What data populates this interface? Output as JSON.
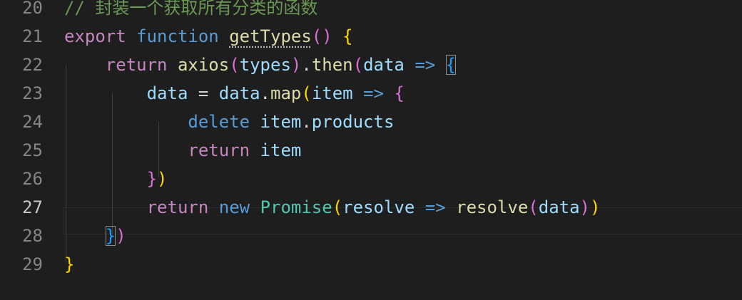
{
  "editor": {
    "theme": "dark",
    "background": "#1e1e1e",
    "active_line": "27",
    "lines": [
      {
        "number": "20",
        "tokens": [
          {
            "text": "// 封装一个获取所有分类的函数",
            "type": "comment"
          }
        ]
      },
      {
        "number": "21",
        "tokens": [
          {
            "text": "export",
            "type": "control"
          },
          {
            "text": " ",
            "type": "op"
          },
          {
            "text": "function",
            "type": "keyword"
          },
          {
            "text": " ",
            "type": "op"
          },
          {
            "text": "getTypes",
            "type": "func",
            "squiggle": true
          },
          {
            "text": "()",
            "type": "b2"
          },
          {
            "text": " ",
            "type": "op"
          },
          {
            "text": "{",
            "type": "b1"
          }
        ]
      },
      {
        "number": "22",
        "tokens": [
          {
            "text": "    ",
            "type": "op"
          },
          {
            "text": "return",
            "type": "control"
          },
          {
            "text": " ",
            "type": "op"
          },
          {
            "text": "axios",
            "type": "func"
          },
          {
            "text": "(",
            "type": "b2"
          },
          {
            "text": "types",
            "type": "var"
          },
          {
            "text": ")",
            "type": "b2"
          },
          {
            "text": ".",
            "type": "op"
          },
          {
            "text": "then",
            "type": "func"
          },
          {
            "text": "(",
            "type": "b2"
          },
          {
            "text": "data",
            "type": "var"
          },
          {
            "text": " ",
            "type": "op"
          },
          {
            "text": "=>",
            "type": "keyword"
          },
          {
            "text": " ",
            "type": "op"
          },
          {
            "text": "{",
            "type": "b3",
            "boxed": true
          }
        ]
      },
      {
        "number": "23",
        "tokens": [
          {
            "text": "        ",
            "type": "op"
          },
          {
            "text": "data",
            "type": "var"
          },
          {
            "text": " = ",
            "type": "op"
          },
          {
            "text": "data",
            "type": "var"
          },
          {
            "text": ".",
            "type": "op"
          },
          {
            "text": "map",
            "type": "func"
          },
          {
            "text": "(",
            "type": "b1"
          },
          {
            "text": "item",
            "type": "var"
          },
          {
            "text": " ",
            "type": "op"
          },
          {
            "text": "=>",
            "type": "keyword"
          },
          {
            "text": " ",
            "type": "op"
          },
          {
            "text": "{",
            "type": "b2"
          }
        ]
      },
      {
        "number": "24",
        "tokens": [
          {
            "text": "            ",
            "type": "op"
          },
          {
            "text": "delete",
            "type": "keyword"
          },
          {
            "text": " ",
            "type": "op"
          },
          {
            "text": "item",
            "type": "var"
          },
          {
            "text": ".",
            "type": "op"
          },
          {
            "text": "products",
            "type": "var"
          }
        ]
      },
      {
        "number": "25",
        "tokens": [
          {
            "text": "            ",
            "type": "op"
          },
          {
            "text": "return",
            "type": "control"
          },
          {
            "text": " ",
            "type": "op"
          },
          {
            "text": "item",
            "type": "var"
          }
        ]
      },
      {
        "number": "26",
        "tokens": [
          {
            "text": "        ",
            "type": "op"
          },
          {
            "text": "}",
            "type": "b2"
          },
          {
            "text": ")",
            "type": "b1"
          }
        ]
      },
      {
        "number": "27",
        "tokens": [
          {
            "text": "        ",
            "type": "op"
          },
          {
            "text": "return",
            "type": "control"
          },
          {
            "text": " ",
            "type": "op"
          },
          {
            "text": "new",
            "type": "keyword"
          },
          {
            "text": " ",
            "type": "op"
          },
          {
            "text": "Promise",
            "type": "class"
          },
          {
            "text": "(",
            "type": "b1"
          },
          {
            "text": "resolve",
            "type": "var"
          },
          {
            "text": " ",
            "type": "op"
          },
          {
            "text": "=>",
            "type": "keyword"
          },
          {
            "text": " ",
            "type": "op"
          },
          {
            "text": "resolve",
            "type": "func"
          },
          {
            "text": "(",
            "type": "b2"
          },
          {
            "text": "data",
            "type": "var"
          },
          {
            "text": ")",
            "type": "b2"
          },
          {
            "text": ")",
            "type": "b1"
          }
        ]
      },
      {
        "number": "28",
        "tokens": [
          {
            "text": "    ",
            "type": "op"
          },
          {
            "text": "}",
            "type": "b3",
            "boxed": true
          },
          {
            "text": ")",
            "type": "b2"
          }
        ]
      },
      {
        "number": "29",
        "tokens": [
          {
            "text": "}",
            "type": "b1"
          }
        ]
      }
    ]
  }
}
